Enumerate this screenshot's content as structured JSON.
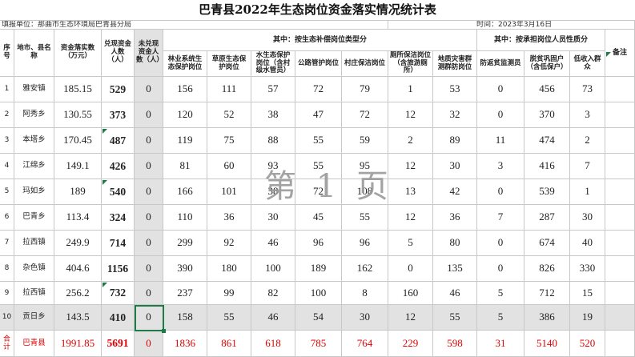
{
  "title": "巴青县2022年生态岗位资金落实情况统计表",
  "unit_label": "填报单位：那曲市生态环境局巴青县分局",
  "date_label": "时间：2023年3月16日",
  "headers": {
    "index": "序号",
    "town": "地市、县名称",
    "funds": "资金落实数（万元）",
    "people": "兑现资金人数（人）",
    "unpaid": "未兑现资金人数（人）",
    "group1": "其中：按生态补偿岗位类型分",
    "group2": "其中：按承担岗位人员性质分",
    "remark": "备注",
    "sub": [
      "林业系统生态保护岗位",
      "草原生态保护岗位",
      "水生态保护岗位（含村级水管员）",
      "公路管护岗位",
      "村庄保洁岗位",
      "厕所保洁岗位（含旅游厕所）",
      "地质灾害群测群防岗位",
      "防返贫监测员",
      "脱贫巩固户（含低保户）",
      "低收入群众"
    ]
  },
  "rows": [
    {
      "idx": "1",
      "town": "雅安镇",
      "funds": "185.15",
      "people": "529",
      "unpaid": "0",
      "v": [
        "156",
        "111",
        "57",
        "72",
        "79",
        "1",
        "53",
        "0",
        "456",
        "73"
      ]
    },
    {
      "idx": "2",
      "town": "阿秀乡",
      "funds": "130.55",
      "people": "373",
      "unpaid": "0",
      "v": [
        "120",
        "52",
        "38",
        "47",
        "72",
        "12",
        "32",
        "0",
        "370",
        "3"
      ]
    },
    {
      "idx": "3",
      "town": "本塔乡",
      "funds": "170.45",
      "people": "487",
      "unpaid": "0",
      "v": [
        "119",
        "75",
        "88",
        "55",
        "59",
        "2",
        "89",
        "11",
        "474",
        "2"
      ]
    },
    {
      "idx": "4",
      "town": "江绵乡",
      "funds": "149.1",
      "people": "426",
      "unpaid": "0",
      "v": [
        "81",
        "60",
        "93",
        "55",
        "95",
        "12",
        "30",
        "3",
        "416",
        "7"
      ]
    },
    {
      "idx": "5",
      "town": "玛如乡",
      "funds": "189",
      "people": "540",
      "unpaid": "0",
      "v": [
        "166",
        "101",
        "38",
        "72",
        "108",
        "13",
        "42",
        "0",
        "539",
        "1"
      ]
    },
    {
      "idx": "6",
      "town": "巴青乡",
      "funds": "113.4",
      "people": "324",
      "unpaid": "0",
      "v": [
        "110",
        "36",
        "30",
        "45",
        "55",
        "12",
        "36",
        "7",
        "287",
        "30"
      ]
    },
    {
      "idx": "7",
      "town": "拉西镇",
      "funds": "249.9",
      "people": "714",
      "unpaid": "0",
      "v": [
        "299",
        "92",
        "46",
        "96",
        "96",
        "5",
        "80",
        "0",
        "674",
        "40"
      ]
    },
    {
      "idx": "8",
      "town": "杂色镇",
      "funds": "404.6",
      "people": "1156",
      "unpaid": "0",
      "v": [
        "390",
        "180",
        "100",
        "189",
        "162",
        "0",
        "135",
        "0",
        "826",
        "330"
      ]
    },
    {
      "idx": "9",
      "town": "拉西镇",
      "funds": "256.2",
      "people": "732",
      "unpaid": "0",
      "v": [
        "237",
        "99",
        "82",
        "100",
        "8",
        "160",
        "46",
        "5",
        "712",
        "15"
      ]
    },
    {
      "idx": "10",
      "town": "贡日乡",
      "funds": "143.5",
      "people": "410",
      "unpaid": "0",
      "v": [
        "158",
        "55",
        "46",
        "54",
        "30",
        "12",
        "55",
        "5",
        "386",
        "19"
      ]
    }
  ],
  "total": {
    "idx": "合计",
    "town": "巴青县",
    "funds": "1991.85",
    "people": "5691",
    "unpaid": "0",
    "v": [
      "1836",
      "861",
      "618",
      "785",
      "764",
      "229",
      "598",
      "31",
      "5140",
      "520"
    ]
  },
  "watermark": "第 1 页"
}
